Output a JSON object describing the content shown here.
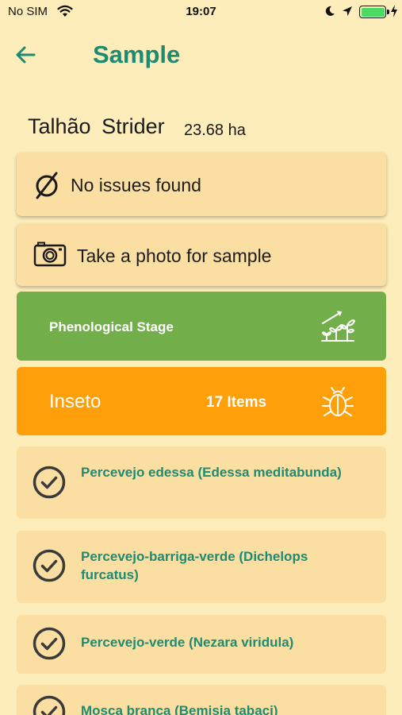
{
  "status_bar": {
    "carrier": "No SIM",
    "time": "19:07",
    "battery_level": 1.0,
    "charging": true
  },
  "header": {
    "title": "Sample",
    "back_icon": "arrow-left-icon"
  },
  "field": {
    "name": "Talhão Strider",
    "area": "23.68 ha"
  },
  "actions": {
    "no_issues_label": "No issues found",
    "photo_label": "Take a photo for sample"
  },
  "phenological": {
    "label": "Phenological Stage",
    "icon": "plant-growth-icon",
    "color": "#72af4a"
  },
  "category": {
    "label": "Inseto",
    "count": "17 Items",
    "icon": "bug-icon",
    "color": "#ff9f0a"
  },
  "items": [
    {
      "label": "Percevejo edessa (Edessa meditabunda)"
    },
    {
      "label": "Percevejo-barriga-verde (Dichelops furcatus)"
    },
    {
      "label": "Percevejo-verde (Nezara viridula)"
    },
    {
      "label": "Mosca branca (Bemisia tabaci)"
    }
  ],
  "colors": {
    "background": "#fdedbb",
    "card": "#fbdfa2",
    "accent": "#1e8a72"
  }
}
